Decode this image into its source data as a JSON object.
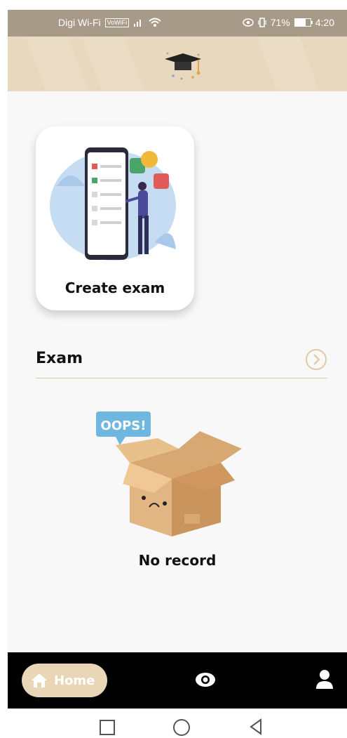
{
  "status_bar": {
    "carrier": "Digi Wi-Fi",
    "volte": "VoWiFi",
    "battery": "71%",
    "time": "4:20"
  },
  "header": {
    "logo_icon": "graduation-cap-icon"
  },
  "card": {
    "label": "Create exam",
    "illustration": "exam-checklist-illustration"
  },
  "exam_section": {
    "title": "Exam",
    "next_icon": "chevron-right-circle-icon"
  },
  "empty_state": {
    "speech": "OOPS!",
    "text": "No record"
  },
  "bottom_nav": {
    "home_label": "Home",
    "eye_icon": "eye-icon",
    "profile_icon": "user-icon"
  },
  "colors": {
    "accent": "#e9d6b6",
    "header_bg": "#e8d8bd",
    "statusbar_bg": "#a89a88",
    "nav_bg": "#000000"
  }
}
